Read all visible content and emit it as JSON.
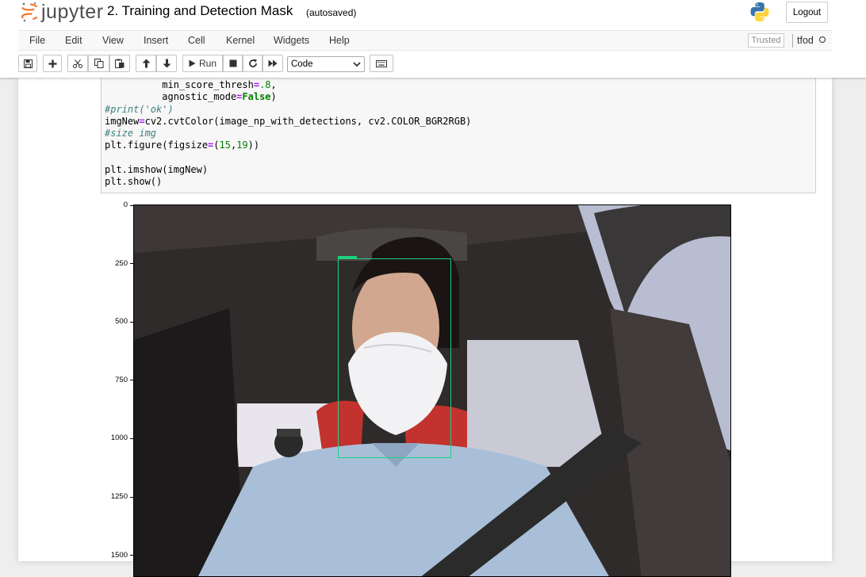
{
  "header": {
    "logo_text": "jupyter",
    "notebook_title": "2. Training and Detection Mask",
    "checkpoint_status": "(autosaved)",
    "logout_label": "Logout"
  },
  "menubar": {
    "items": [
      "File",
      "Edit",
      "View",
      "Insert",
      "Cell",
      "Kernel",
      "Widgets",
      "Help"
    ],
    "trusted_label": "Trusted",
    "kernel_name": "tfod"
  },
  "toolbar": {
    "run_label": "Run",
    "cell_type": "Code",
    "icons": [
      "save-icon",
      "add-cell-icon",
      "cut-icon",
      "copy-icon",
      "paste-icon",
      "move-up-icon",
      "move-down-icon",
      "run-icon",
      "stop-icon",
      "restart-icon",
      "fast-forward-icon",
      "keyboard-icon"
    ]
  },
  "code_cell": {
    "lines": [
      "          min_score_thresh=.8,",
      "          agnostic_mode=False)",
      "#print('ok')",
      "imgNew=cv2.cvtColor(image_np_with_detections, cv2.COLOR_BGR2RGB)",
      "#size img",
      "plt.figure(figsize=(15,19))",
      "",
      "plt.imshow(imgNew)",
      "plt.show()"
    ]
  },
  "output_plot": {
    "y_ticks": [
      "0",
      "250",
      "500",
      "750",
      "1000",
      "1250",
      "1500"
    ],
    "detection_box_color": "#1bd27f"
  },
  "colors": {
    "accent": "#f37726",
    "detection": "#1bd27f",
    "code_keyword": "#008000",
    "code_operator": "#aa22ff",
    "code_comment": "#408080"
  }
}
